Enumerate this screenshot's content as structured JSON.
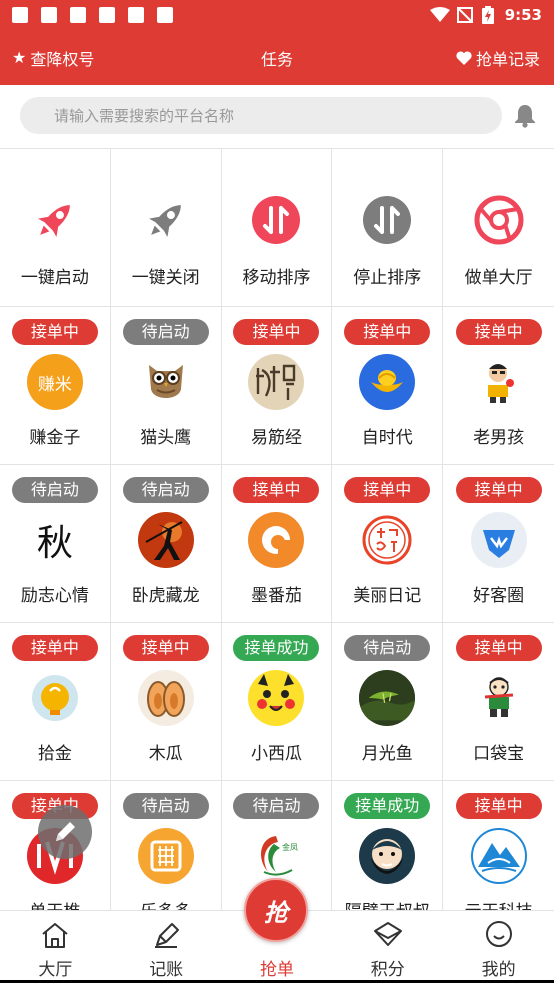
{
  "status_bar": {
    "time": "9:53"
  },
  "header": {
    "left_label": "查降权号",
    "title": "任务",
    "right_label": "抢单记录",
    "bg_color": "#dd3b34"
  },
  "search": {
    "placeholder": "请输入需要搜索的平台名称"
  },
  "actions": [
    {
      "label": "一键启动",
      "icon": "rocket-icon",
      "color": "#f0465a"
    },
    {
      "label": "一键关闭",
      "icon": "rocket-icon",
      "color": "#7d7d7d"
    },
    {
      "label": "移动排序",
      "icon": "sort-arrows-icon",
      "color": "#f0465a"
    },
    {
      "label": "停止排序",
      "icon": "sort-arrows-icon",
      "color": "#7d7d7d"
    },
    {
      "label": "做单大厅",
      "icon": "aperture-icon",
      "color": "#f0465a"
    }
  ],
  "apps": [
    {
      "name": "赚金子",
      "status": "接单中",
      "state": "run",
      "logo_text": "赚米"
    },
    {
      "name": "猫头鹰",
      "status": "待启动",
      "state": "wait"
    },
    {
      "name": "易筋经",
      "status": "接单中",
      "state": "run"
    },
    {
      "name": "自时代",
      "status": "接单中",
      "state": "run"
    },
    {
      "name": "老男孩",
      "status": "接单中",
      "state": "run"
    },
    {
      "name": "励志心情",
      "status": "待启动",
      "state": "wait",
      "logo_text": "秋"
    },
    {
      "name": "卧虎藏龙",
      "status": "待启动",
      "state": "wait"
    },
    {
      "name": "墨番茄",
      "status": "接单中",
      "state": "run"
    },
    {
      "name": "美丽日记",
      "status": "接单中",
      "state": "run"
    },
    {
      "name": "好客圈",
      "status": "接单中",
      "state": "run"
    },
    {
      "name": "拾金",
      "status": "接单中",
      "state": "run"
    },
    {
      "name": "木瓜",
      "status": "接单中",
      "state": "run"
    },
    {
      "name": "小西瓜",
      "status": "接单成功",
      "state": "ok"
    },
    {
      "name": "月光鱼",
      "status": "待启动",
      "state": "wait"
    },
    {
      "name": "口袋宝",
      "status": "接单中",
      "state": "run"
    },
    {
      "name": "单天椎",
      "status": "接单中",
      "state": "run"
    },
    {
      "name": "乐多多",
      "status": "待启动",
      "state": "wait"
    },
    {
      "name": "",
      "status": "待启动",
      "state": "wait",
      "logo_text": "金凤"
    },
    {
      "name": "隔壁王叔叔",
      "status": "接单成功",
      "state": "ok"
    },
    {
      "name": "云天科技",
      "status": "接单中",
      "state": "run"
    }
  ],
  "bottom_nav": [
    {
      "label": "大厅",
      "icon": "home-icon"
    },
    {
      "label": "记账",
      "icon": "pen-icon"
    },
    {
      "label": "抢单",
      "icon": "grab-icon",
      "active": true
    },
    {
      "label": "积分",
      "icon": "diamond-icon"
    },
    {
      "label": "我的",
      "icon": "profile-icon"
    }
  ],
  "grab_button": {
    "label": "抢"
  }
}
